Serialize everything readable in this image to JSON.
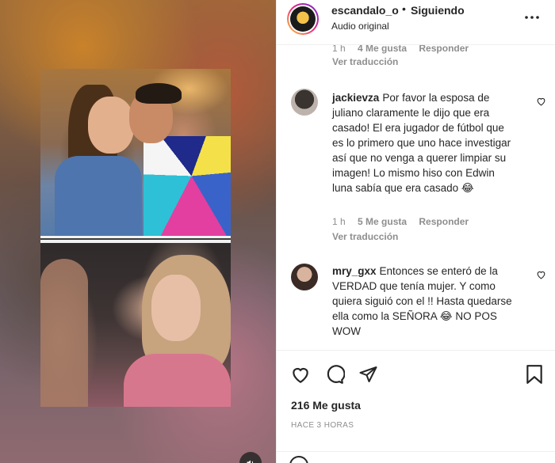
{
  "post": {
    "username": "escandalo_o",
    "separator": "•",
    "follow_status": "Siguiendo",
    "audio": "Audio original",
    "more_icon": "more-horizontal-icon"
  },
  "comments_prev": {
    "time": "1 h",
    "likes": "4 Me gusta",
    "reply": "Responder",
    "translate": "Ver traducción"
  },
  "comments": [
    {
      "user": "jackievza",
      "text": "Por favor la esposa de juliano claramente le dijo que era casado! El era jugador de fútbol que es lo primero que uno hace investigar así que no venga a querer limpiar su imagen! Lo mismo hiso con Edwin luna sabía que era casado 😂",
      "time": "1 h",
      "likes": "5 Me gusta",
      "reply": "Responder",
      "translate": "Ver traducción"
    },
    {
      "user": "mry_gxx",
      "text": "Entonces se enteró de la VERDAD que tenía mujer. Y como quiera siguió con el !! Hasta quedarse ella como la SEÑORA 😂 NO POS WOW"
    }
  ],
  "actions": {
    "likes_count": "216 Me gusta",
    "time_ago": "HACE 3 HORAS"
  },
  "colors": {
    "text": "#262626",
    "muted": "#8e8e8e",
    "border": "#efefef"
  }
}
